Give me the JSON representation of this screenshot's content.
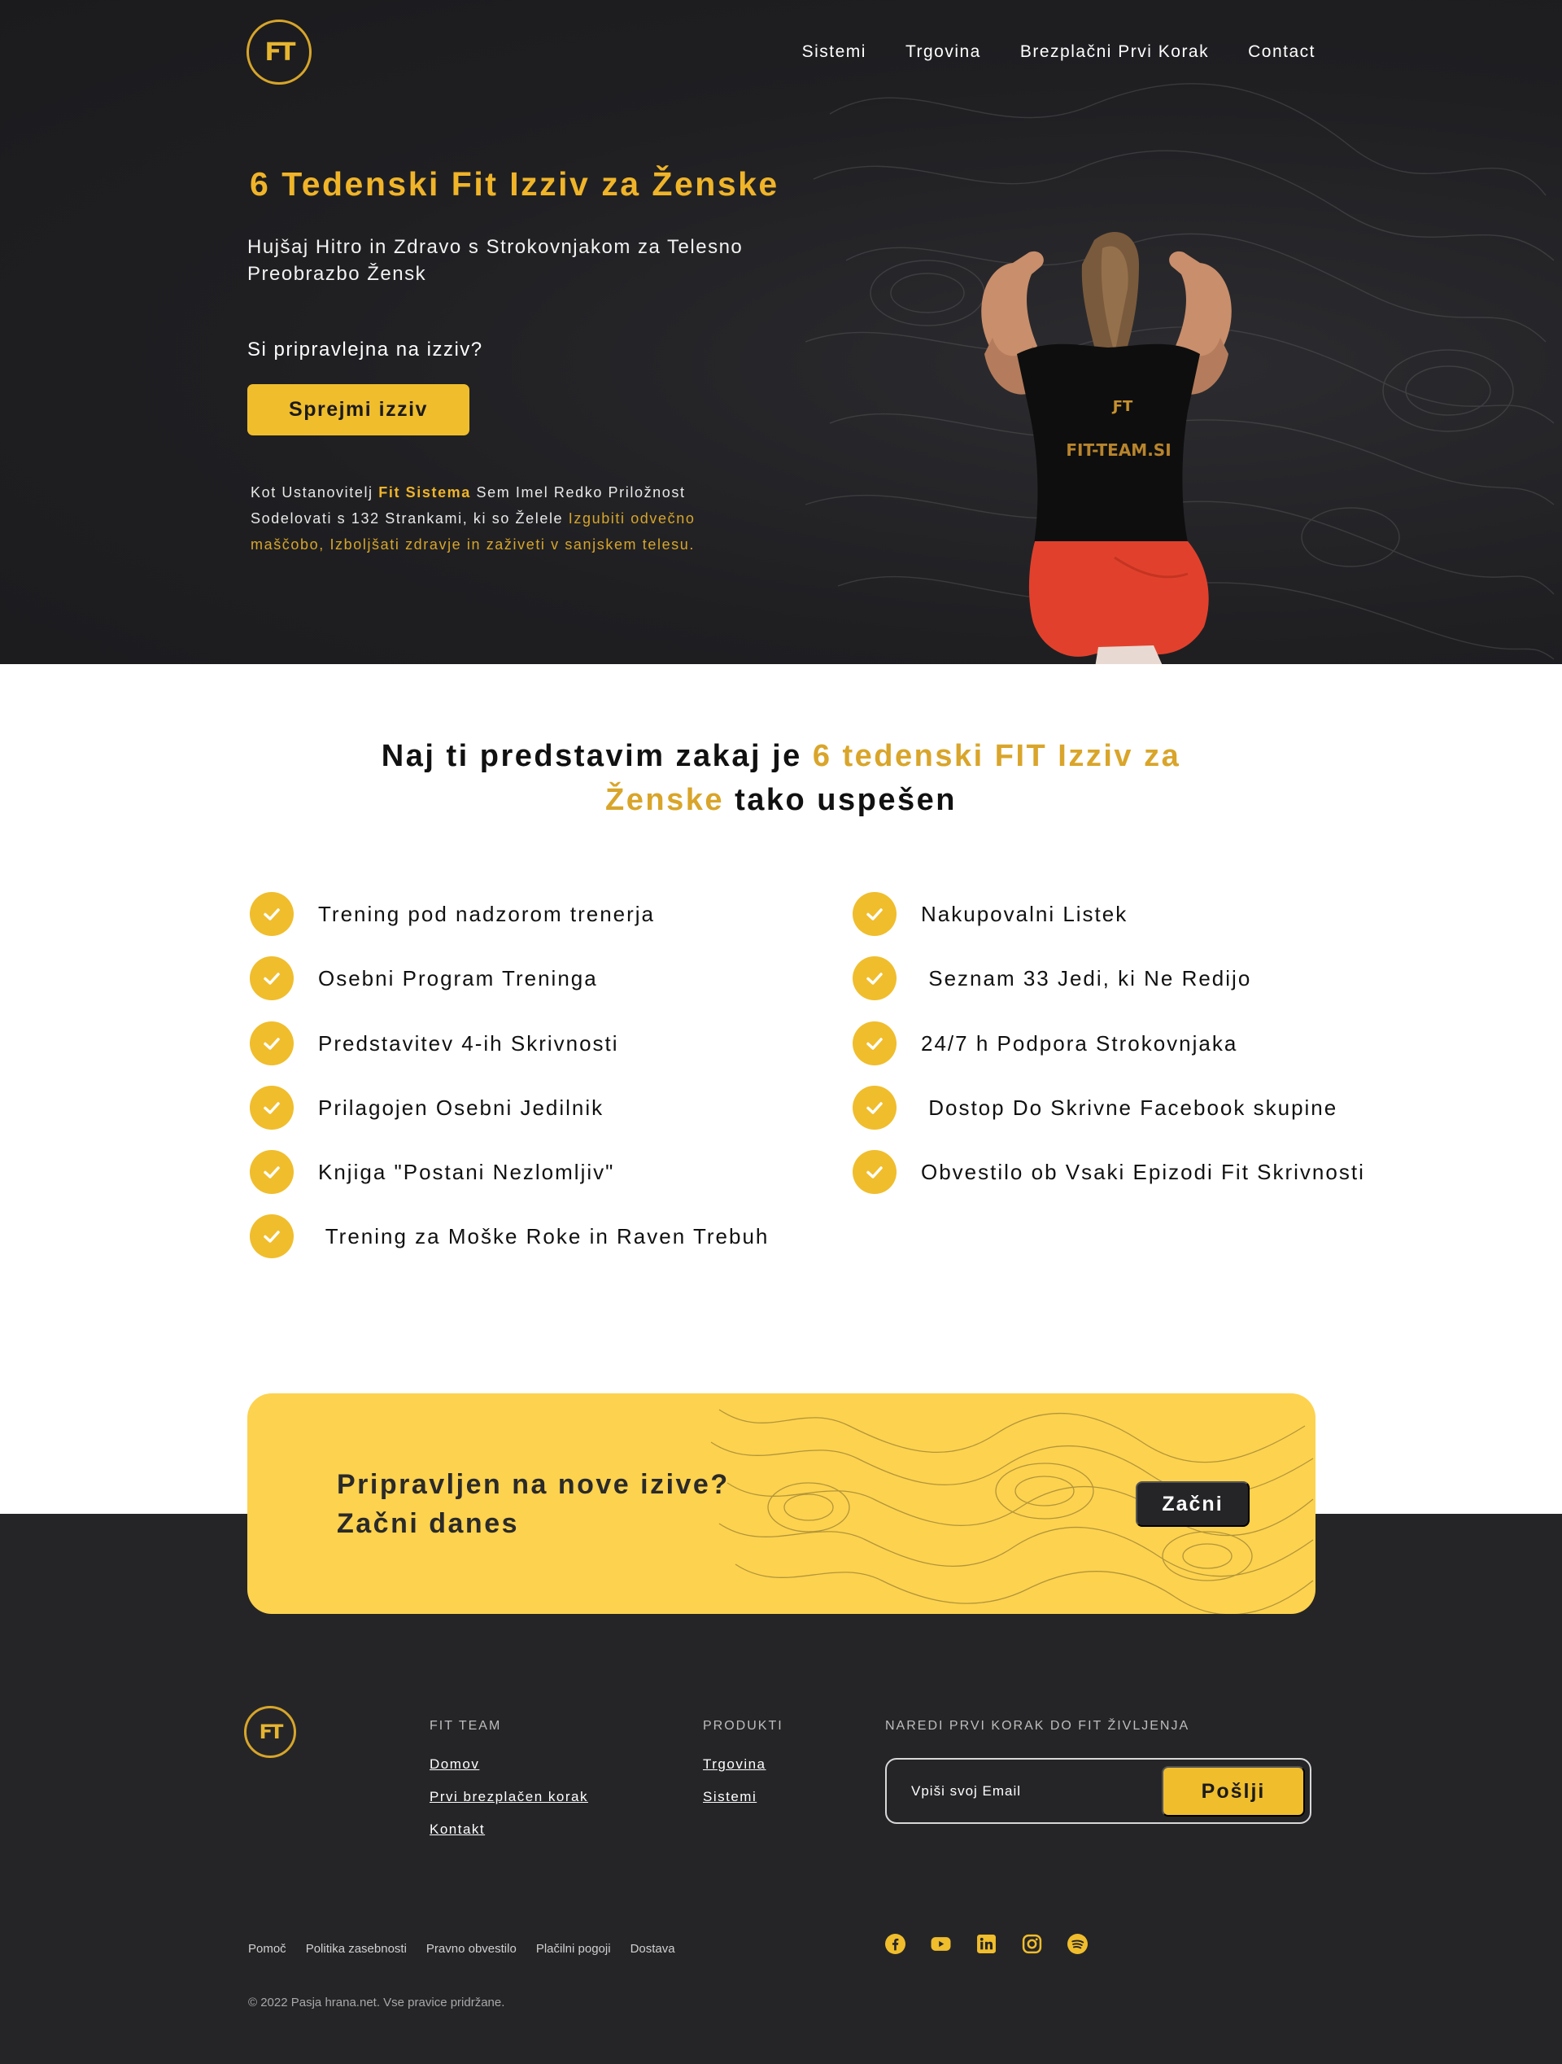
{
  "brand": {
    "logo_text": "FT"
  },
  "nav": {
    "items": [
      "Sistemi",
      "Trgovina",
      "Brezplačni Prvi Korak",
      "Contact"
    ]
  },
  "hero": {
    "title": "6 Tedenski Fit Izziv za Ženske",
    "subtitle": "Hujšaj Hitro in Zdravo s Strokovnjakom za Telesno Preobrazbo Žensk",
    "question": "Si  pripravlejna  na izziv?",
    "button": "Sprejmi izziv",
    "text_1": "Kot Ustanovitelj ",
    "text_hl": "Fit Sistema",
    "text_2": " Sem Imel Redko Priložnost Sodelovati s 132 Strankami, ki so Želele ",
    "text_hl2": "Izgubiti odvečno maščobo, Izboljšati zdravje in zaživeti v sanjskem telesu.",
    "shirt_text": "FIT-TEAM.SI"
  },
  "features": {
    "title_1": "Naj ti predstavim zakaj je ",
    "title_gold_1": "6 tedenski FIT Izziv za Ženske",
    "title_2": " tako uspešen",
    "left": [
      "Trening pod nadzorom trenerja",
      "Osebni Program Treninga",
      "Predstavitev 4-ih Skrivnosti",
      "Prilagojen Osebni Jedilnik",
      "Knjiga \"Postani Nezlomljiv\"",
      " Trening za Moške Roke in Raven Trebuh"
    ],
    "right": [
      "Nakupovalni Listek",
      " Seznam 33 Jedi, ki Ne Redijo",
      "24/7 h Podpora Strokovnjaka",
      " Dostop Do Skrivne Facebook skupine",
      "Obvestilo ob Vsaki Epizodi Fit Skrivnosti"
    ]
  },
  "cta": {
    "line_1": "Pripravljen na nove izive?",
    "line_2": "Začni danes",
    "button": "Začni"
  },
  "footer": {
    "col1_title": "FIT TEAM",
    "col1_links": [
      "Domov",
      "Prvi brezplačen korak",
      "Kontakt"
    ],
    "col2_title": "PRODUKTI",
    "col2_links": [
      "Trgovina",
      "Sistemi"
    ],
    "newsletter_title": "NAREDI PRVI KORAK DO FIT ŽIVLJENJA",
    "email_placeholder": "Vpiši svoj Email",
    "send_button": "Pošlji",
    "legal_links": [
      "Pomoč",
      "Politika zasebnosti",
      "Pravno obvestilo",
      "Plačilni pogoji",
      "Dostava"
    ],
    "social_icons": [
      "facebook-icon",
      "youtube-icon",
      "linkedin-icon",
      "instagram-icon",
      "spotify-icon"
    ],
    "copyright": "© 2022 Pasja hrana.net. Vse pravice pridržane."
  },
  "colors": {
    "gold": "#f0bd2c",
    "dark": "#252528",
    "cta_bg": "#fdd24e"
  }
}
